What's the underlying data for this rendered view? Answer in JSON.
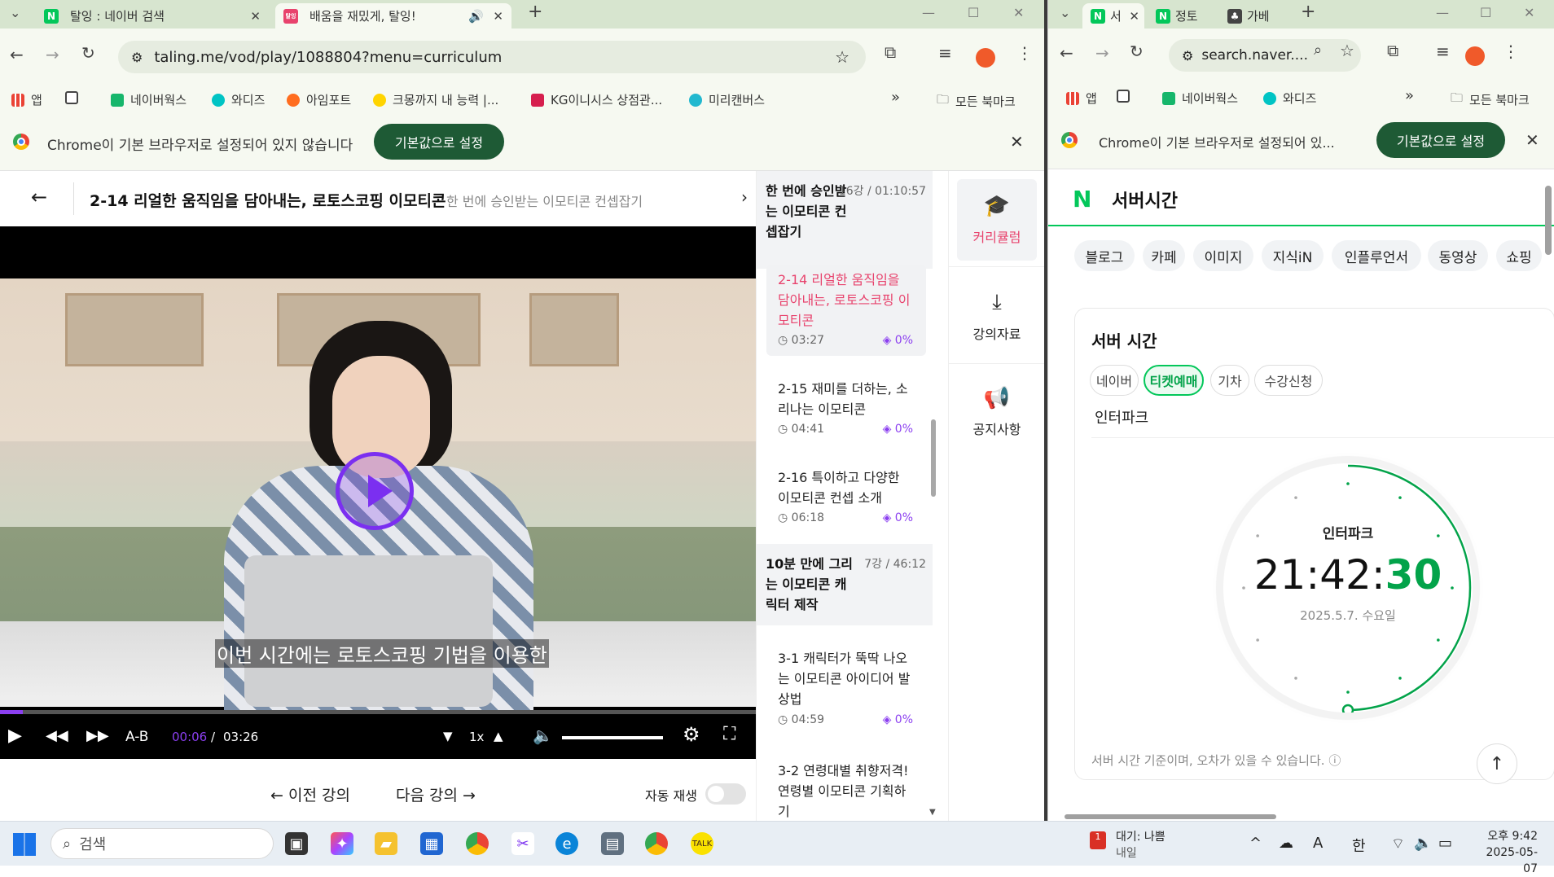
{
  "left_window": {
    "tabs": [
      {
        "title": "탈잉 : 네이버 검색",
        "favicon": "N"
      },
      {
        "title": "배움을 재밌게, 탈잉!",
        "favicon": "탈잉"
      }
    ],
    "url": "taling.me/vod/play/1088804?menu=curriculum",
    "bookmarks": [
      "앱",
      "네이버웍스",
      "와디즈",
      "아임포트",
      "크몽까지 내 능력 |...",
      "KG이니시스 상점관...",
      "미리캔버스"
    ],
    "all_bookmarks": "모든 북마크",
    "infobar": {
      "message": "Chrome이 기본 브라우저로 설정되어 있지 않습니다",
      "button": "기본값으로 설정"
    },
    "lesson": {
      "title": "2-14 리얼한 움직임을 담아내는, 로토스코핑 이모티콘",
      "subtitle": "한 번에 승인받는 이모티콘 컨셉잡기",
      "caption": "이번 시간에는 로토스코핑 기법을 이용한",
      "current_time": "00:06",
      "separator": "/",
      "duration": "03:26",
      "ab": "A-B",
      "speed": "1x",
      "progress": 0.03,
      "prev": "이전 강의",
      "next": "다음 강의",
      "autoplay": "자동 재생"
    },
    "curriculum": {
      "sections": [
        {
          "title": "한 번에 승인받는 이모티콘 컨셉잡기",
          "meta": "16강 / 01:10:57"
        },
        {
          "title": "10분 만에 그리는 이모티콘 캐릭터 제작",
          "meta": "7강 / 46:12"
        }
      ],
      "items": [
        {
          "title": "2-14 리얼한 움직임을 담아내는, 로토스코핑 이모티콘",
          "duration": "03:27",
          "progress": "0%"
        },
        {
          "title": "2-15 재미를 더하는, 소리나는 이모티콘",
          "duration": "04:41",
          "progress": "0%"
        },
        {
          "title": "2-16 특이하고 다양한 이모티콘 컨셉 소개",
          "duration": "06:18",
          "progress": "0%"
        },
        {
          "title": "3-1 캐릭터가 뚝딱 나오는 이모티콘 아이디어 발상법",
          "duration": "04:59",
          "progress": "0%"
        },
        {
          "title": "3-2 연령대별 취향저격! 연령별 이모티콘 기획하기",
          "duration": "",
          "progress": ""
        }
      ]
    },
    "side_menu": [
      "커리큘럼",
      "강의자료",
      "공지사항"
    ]
  },
  "right_window": {
    "tabs": [
      {
        "title": "서",
        "favicon": "N"
      },
      {
        "title": "정토",
        "favicon": "N"
      },
      {
        "title": "가베",
        "favicon": ""
      }
    ],
    "url": "search.naver....",
    "bookmarks": [
      "앱",
      "네이버웍스",
      "와디즈"
    ],
    "all_bookmarks": "모든 북마크",
    "infobar": {
      "message": "Chrome이 기본 브라우저로 설정되어 있...",
      "button": "기본값으로 설정"
    },
    "page_title": "서버시간",
    "search_tabs": [
      "블로그",
      "카페",
      "이미지",
      "지식iN",
      "인플루언서",
      "동영상",
      "쇼핑"
    ],
    "card_title": "서버 시간",
    "options": [
      "네이버",
      "티켓예매",
      "기차",
      "수강신청"
    ],
    "selected_option": "티켓예매",
    "site": "인터파크",
    "clock": {
      "site": "인터파크",
      "hhmm": "21:42:",
      "seconds": "30",
      "date": "2025.5.7. 수요일"
    },
    "note": "서버 시간 기준이며, 오차가 있을 수 있습니다."
  },
  "taskbar": {
    "search": "검색",
    "notification": {
      "title": "대기: 나쁨",
      "sub": "내일",
      "badge": "1"
    },
    "ime": [
      "A",
      "한"
    ],
    "time": "오후 9:42",
    "date": "2025-05-07"
  }
}
